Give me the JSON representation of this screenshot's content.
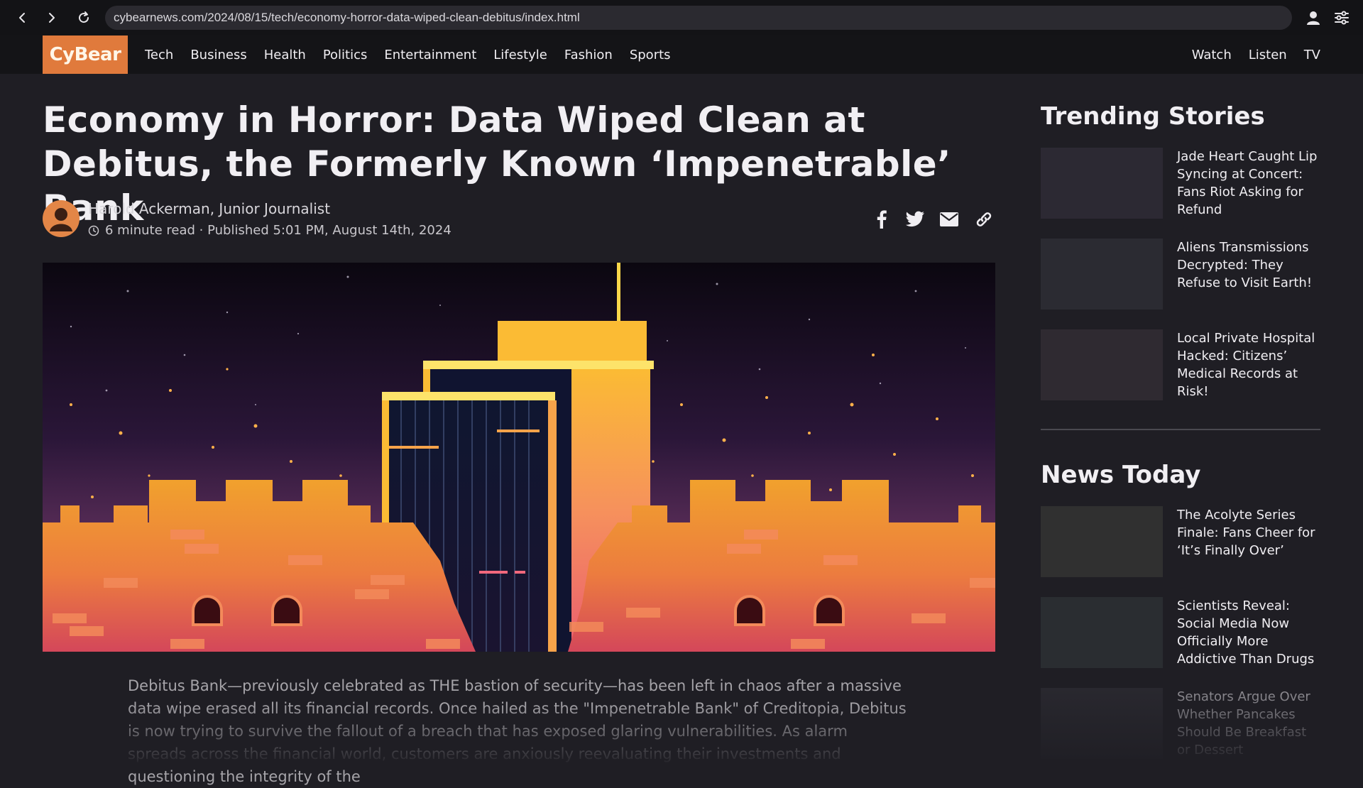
{
  "browser": {
    "url": "cybearnews.com/2024/08/15/tech/economy-horror-data-wiped-clean-debitus/index.html"
  },
  "site": {
    "logo": "CyBear",
    "nav": [
      "Tech",
      "Business",
      "Health",
      "Politics",
      "Entertainment",
      "Lifestyle",
      "Fashion",
      "Sports"
    ],
    "right_nav": [
      "Watch",
      "Listen",
      "TV"
    ],
    "accent": "#e07a3c"
  },
  "article": {
    "headline": "Economy in Horror: Data Wiped Clean at Debitus, the Formerly Known ‘Impenetrable’ Bank",
    "author": "Harold Ackerman, Junior Journalist",
    "meta": "6 minute read · Published 5:01 PM, August 14th, 2024",
    "body": "Debitus Bank—previously celebrated as THE bastion of security—has been left in chaos after a massive data wipe erased all its financial records. Once hailed as the \"Impenetrable Bank\" of Creditopia, Debitus is now trying to survive  the fallout of a breach that has exposed glaring vulnerabilities. As alarm spreads across the financial world, customers are anxiously reevaluating their investments and questioning the integrity of the"
  },
  "icons": {
    "back": "back-arrow-icon",
    "forward": "forward-arrow-icon",
    "reload": "reload-icon",
    "account": "account-icon",
    "settings": "settings-sliders-icon",
    "clock": "clock-icon",
    "share": [
      "facebook-icon",
      "twitter-icon",
      "email-icon",
      "link-icon"
    ]
  },
  "sidebar": {
    "trending_title": "Trending Stories",
    "trending": [
      {
        "title": "Jade Heart Caught Lip Syncing at Concert: Fans Riot Asking for Refund"
      },
      {
        "title": "Aliens Transmissions Decrypted: They Refuse to Visit Earth!"
      },
      {
        "title": "Local Private Hospital Hacked: Citizens’ Medical Records at Risk!"
      }
    ],
    "news_title": "News Today",
    "news": [
      {
        "title": "The Acolyte Series Finale: Fans Cheer for ‘It’s Finally Over’"
      },
      {
        "title": "Scientists Reveal: Social Media Now Officially More Addictive Than Drugs"
      },
      {
        "title": "Senators Argue Over Whether Pancakes Should Be Breakfast or Dessert"
      }
    ]
  }
}
